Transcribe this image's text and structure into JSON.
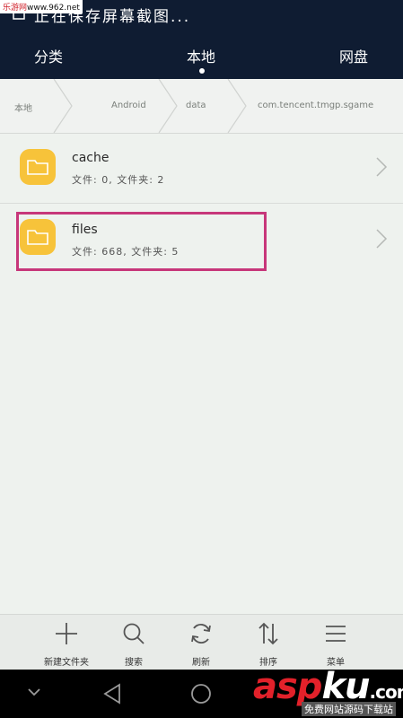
{
  "watermark": {
    "site": "乐游网",
    "url": "www.962.net"
  },
  "status": {
    "notice": "正在保存屏幕截图..."
  },
  "tabs": [
    {
      "label": "分类"
    },
    {
      "label": "本地"
    },
    {
      "label": "网盘"
    }
  ],
  "active_tab": "本地",
  "breadcrumb": [
    "本地",
    "Android",
    "data",
    "com.tencent.tmgp.sgame"
  ],
  "items": [
    {
      "name": "cache",
      "meta": "文件: 0, 文件夹: 2",
      "icon": "folder-icon"
    },
    {
      "name": "files",
      "meta": "文件: 668, 文件夹: 5",
      "icon": "folder-icon"
    }
  ],
  "toolbar": [
    {
      "label": "新建文件夹",
      "icon": "plus-icon"
    },
    {
      "label": "搜索",
      "icon": "search-icon"
    },
    {
      "label": "刷新",
      "icon": "refresh-icon"
    },
    {
      "label": "排序",
      "icon": "sort-icon"
    },
    {
      "label": "菜单",
      "icon": "menu-icon"
    }
  ],
  "brand_watermark": {
    "asp": "asp",
    "ku": "ku",
    "com": ".com",
    "tagline": "免费网站源码下载站"
  },
  "colors": {
    "header": "#0f1c32",
    "folder": "#f7c33a",
    "highlight": "#c7377a",
    "background": "#eef2ee"
  }
}
